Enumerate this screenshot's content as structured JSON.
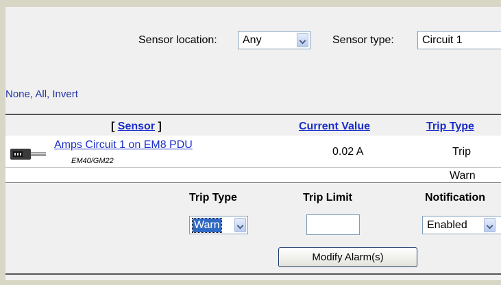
{
  "filters": {
    "location_label": "Sensor location:",
    "location_value": "Any",
    "type_label": "Sensor type:",
    "type_value": "Circuit 1"
  },
  "selection_links": [
    "None",
    "All",
    "Invert"
  ],
  "table": {
    "headers": {
      "sensor_open": "[ ",
      "sensor": "Sensor",
      "sensor_close": " ]",
      "current_value": "Current Value",
      "trip_type": "Trip Type"
    },
    "row": {
      "sensor_name": "Amps Circuit 1 on EM8 PDU",
      "sensor_model": "EM40/GM22",
      "current_value": "0.02 A",
      "trip_types": [
        "Trip",
        "Warn"
      ]
    }
  },
  "modify": {
    "trip_type_label": "Trip Type",
    "trip_limit_label": "Trip Limit",
    "notification_label": "Notification",
    "trip_type_value": "Warn",
    "trip_limit_value": "",
    "notification_value": "Enabled",
    "button_label": "Modify Alarm(s)"
  },
  "icons": {
    "sensor": "pdu-sensor-icon"
  }
}
